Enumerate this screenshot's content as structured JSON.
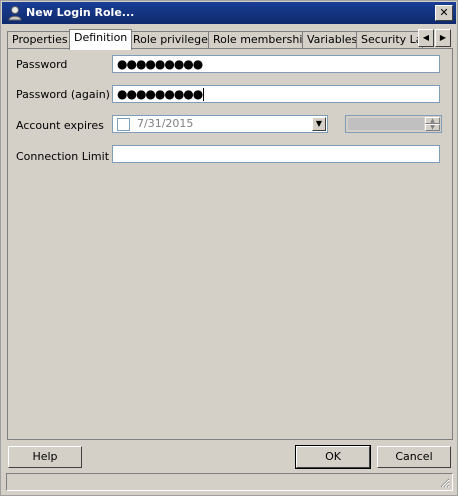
{
  "window": {
    "title": "New Login Role..."
  },
  "tabs": [
    {
      "label": "Properties"
    },
    {
      "label": "Definition"
    },
    {
      "label": "Role privileges"
    },
    {
      "label": "Role membership"
    },
    {
      "label": "Variables"
    },
    {
      "label": "Security Lab"
    }
  ],
  "form": {
    "password_label": "Password",
    "password_value": "●●●●●●●●●",
    "password_again_label": "Password (again)",
    "password_again_value": "●●●●●●●●●",
    "account_expires_label": "Account expires",
    "account_expires_date": "7/31/2015",
    "account_expires_checked": false,
    "connection_limit_label": "Connection Limit",
    "connection_limit_value": ""
  },
  "buttons": {
    "help": "Help",
    "ok": "OK",
    "cancel": "Cancel"
  }
}
